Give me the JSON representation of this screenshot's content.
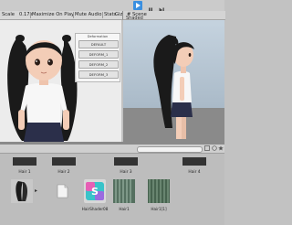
{
  "toolbar": {
    "play_icon": "play-icon",
    "pause_icon": "pause-icon",
    "step_icon": "step-icon",
    "accent": "#3a8fe0"
  },
  "game_view": {
    "scale_label": "Scale",
    "scale_value": "0.17x",
    "maximize_label": "Maximize On Play",
    "mute_label": "Mute Audio",
    "stats_label": "Stats",
    "gizmos_label": "Giz"
  },
  "scene_view": {
    "tab_label": "# Scene",
    "shading_label": "Shaded"
  },
  "deform_panel": {
    "title": "Deformation",
    "buttons": [
      "DEFAULT",
      "DEFORM_1",
      "DEFORM_2",
      "DEFORM_3"
    ]
  },
  "project": {
    "row1_items": [
      "Hair 1",
      "Hair 2",
      "Hair 3",
      "Hair 4"
    ],
    "row2_items": [
      "",
      "",
      "HairShader08",
      "Hair1",
      "Hair1[1]"
    ]
  },
  "colors": {
    "hair": "#1a1a1a",
    "skin": "#f3cdb7",
    "shirt": "#f7f7f7",
    "skirt": "#2b2f4a",
    "sky": "#b9c9d8",
    "ground": "#8a8a8a"
  }
}
